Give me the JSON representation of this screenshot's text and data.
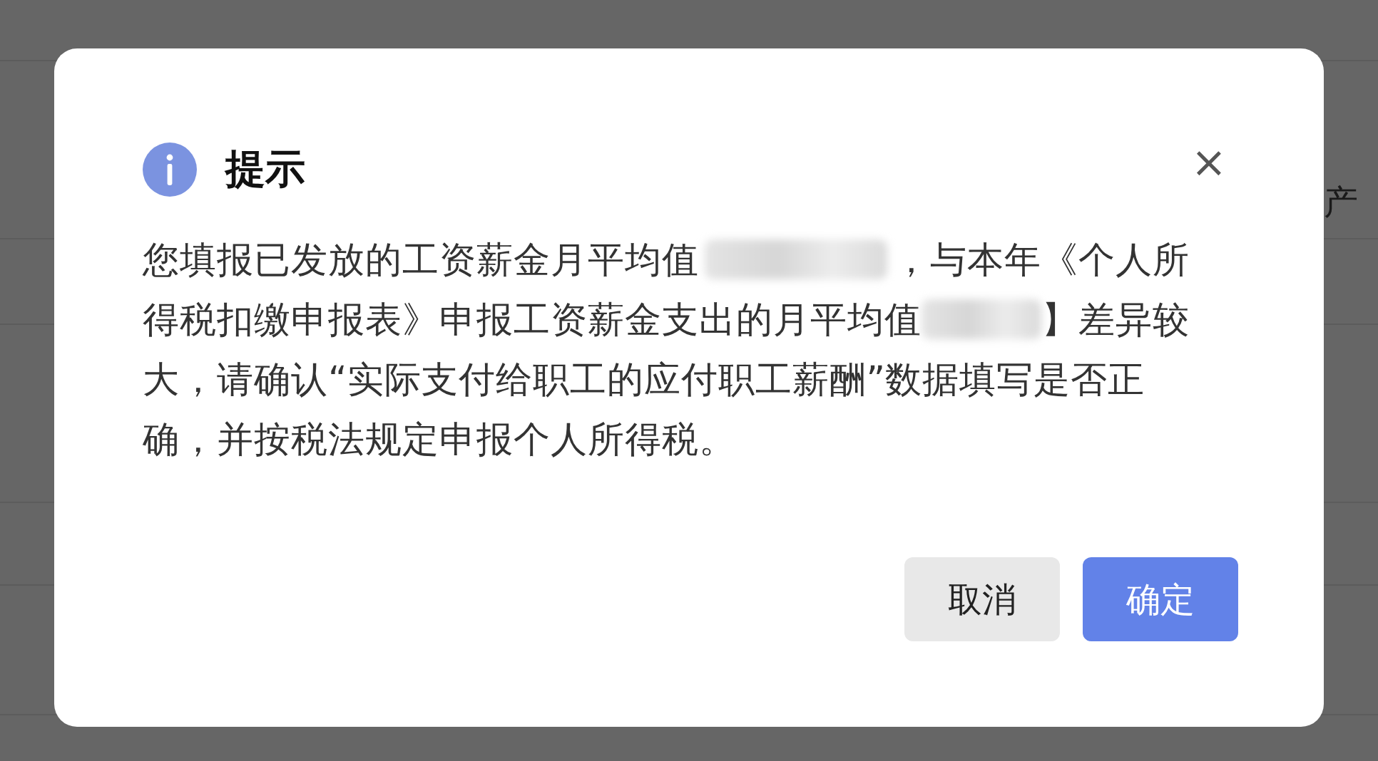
{
  "background": {
    "visible_text": "产"
  },
  "dialog": {
    "title": "提示",
    "close": "×",
    "message": [
      {
        "kind": "text",
        "text": "您填报已发放的工资薪金月平均值"
      },
      {
        "kind": "redacted"
      },
      {
        "kind": "text",
        "text": "，与本年《个人所得税扣缴申报表》申报工资薪金支出的月平均值"
      },
      {
        "kind": "redacted_short"
      },
      {
        "kind": "text",
        "text": "】差异较大，请确认“实际支付给职工的应付职工薪酬”数据填写是否正确，并按税法规定申报个人所得税。"
      }
    ],
    "buttons": [
      {
        "label": "取消",
        "kind": "secondary"
      },
      {
        "label": "确定",
        "kind": "primary"
      }
    ]
  }
}
